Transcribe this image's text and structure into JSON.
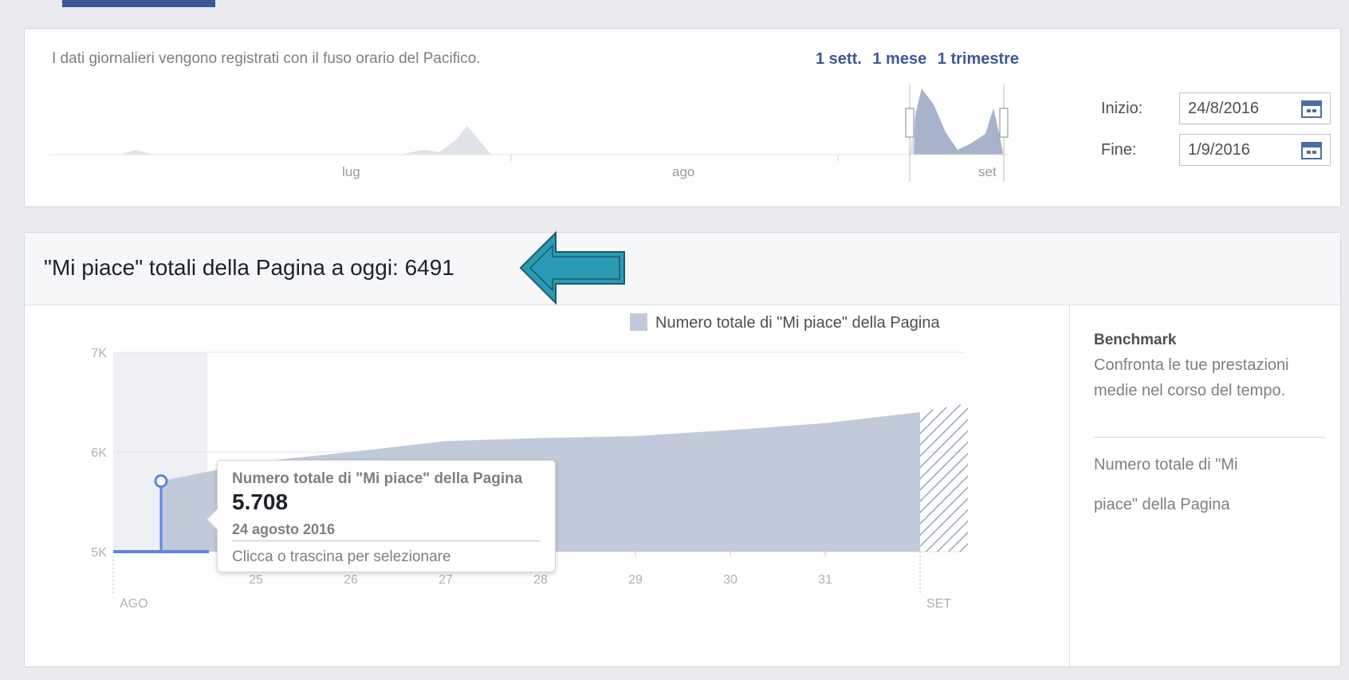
{
  "range": {
    "note": "I dati giornalieri vengono registrati con il fuso orario del Pacifico.",
    "periods": [
      "1 sett.",
      "1 mese",
      "1 trimestre"
    ],
    "months": [
      "lug",
      "ago",
      "set"
    ],
    "start_label": "Inizio:",
    "start_value": "24/8/2016",
    "end_label": "Fine:",
    "end_value": "1/9/2016"
  },
  "likes": {
    "title": "\"Mi piace\" totali della Pagina a oggi: 6491"
  },
  "benchmark": {
    "title": "Benchmark",
    "description": "Confronta le tue prestazioni medie nel corso del tempo.",
    "metric": "Numero totale di \"Mi piace\" della Pagina"
  },
  "tooltip": {
    "title": "Numero totale di \"Mi piace\" della Pagina",
    "value": "5.708",
    "date": "24 agosto 2016",
    "hint": "Clicca o trascina per selezionare"
  },
  "colors": {
    "accent": "#3b5998",
    "area": "#c1cadb",
    "arrow": "#2b9bb4"
  },
  "chart_data": {
    "type": "area",
    "legend": "Numero totale di \"Mi piace\" della Pagina",
    "y_ticks": [
      "7K",
      "6K",
      "5K"
    ],
    "ylim": [
      5000,
      7000
    ],
    "x_ticks": [
      "25",
      "26",
      "27",
      "28",
      "29",
      "30",
      "31"
    ],
    "month_labels": [
      "AGO",
      "SET"
    ],
    "x": [
      24,
      25,
      26,
      27,
      28,
      29,
      30,
      31,
      32
    ],
    "values": [
      5708,
      5900,
      6000,
      6110,
      6140,
      6160,
      6220,
      6290,
      6400
    ],
    "projected_value": 6491,
    "selected_point": {
      "date": "24 agosto 2016",
      "value": 5708
    }
  }
}
